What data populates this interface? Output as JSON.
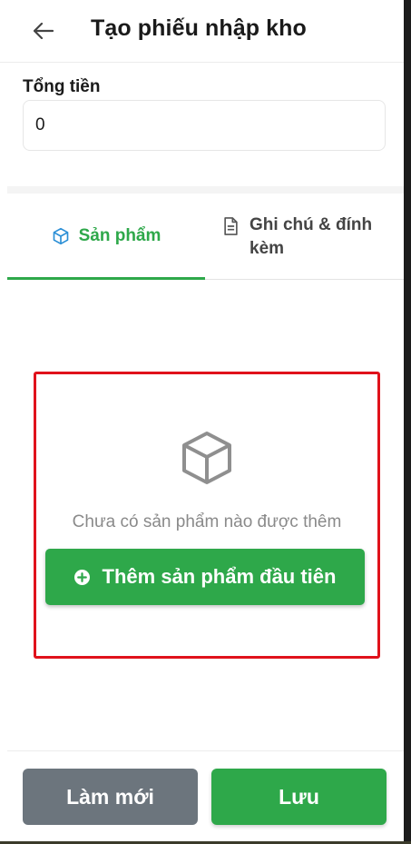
{
  "header": {
    "title": "Tạo phiếu nhập kho",
    "back_icon": "arrow-left-icon"
  },
  "total": {
    "label": "Tổng tiền",
    "value": "0"
  },
  "tabs": [
    {
      "label": "Sản phẩm",
      "icon": "cube-icon",
      "active": true
    },
    {
      "label": "Ghi chú & đính kèm",
      "icon": "document-icon",
      "active": false
    }
  ],
  "empty_state": {
    "icon": "cube-outline-icon",
    "message": "Chưa có sản phẩm nào được thêm",
    "button_label": "Thêm sản phẩm đầu tiên",
    "button_icon": "plus-circle-icon"
  },
  "footer": {
    "reset_label": "Làm mới",
    "save_label": "Lưu"
  },
  "colors": {
    "accent": "#2ea84a",
    "secondary": "#6c757d",
    "highlight_border": "#e0121b"
  }
}
